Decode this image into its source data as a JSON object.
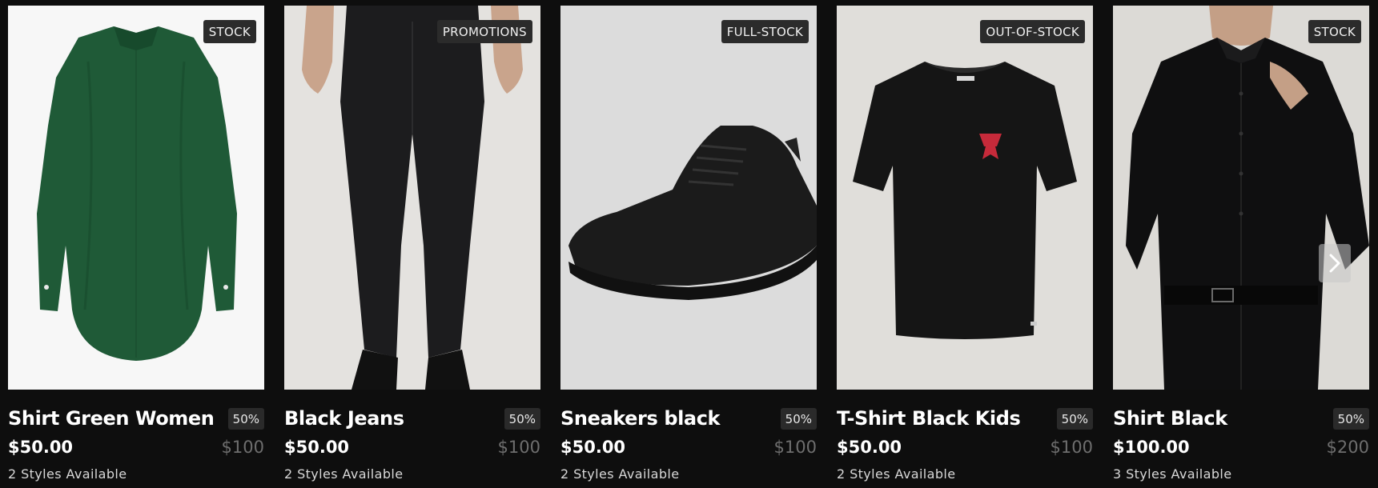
{
  "products": [
    {
      "badge": "STOCK",
      "name": "Shirt Green Women",
      "discount": "50%",
      "price": "$50.00",
      "old_price": "$100",
      "styles": "2 Styles Available"
    },
    {
      "badge": "PROMOTIONS",
      "name": "Black Jeans",
      "discount": "50%",
      "price": "$50.00",
      "old_price": "$100",
      "styles": "2 Styles Available"
    },
    {
      "badge": "FULL-STOCK",
      "name": "Sneakers black",
      "discount": "50%",
      "price": "$50.00",
      "old_price": "$100",
      "styles": "2 Styles Available"
    },
    {
      "badge": "OUT-OF-STOCK",
      "name": "T-Shirt Black Kids",
      "discount": "50%",
      "price": "$50.00",
      "old_price": "$100",
      "styles": "2 Styles Available"
    },
    {
      "badge": "STOCK",
      "name": "Shirt Black",
      "discount": "50%",
      "price": "$100.00",
      "old_price": "$200",
      "styles": "3 Styles Available"
    }
  ],
  "carousel": {
    "next_icon": "chevron-right-icon"
  },
  "colors": {
    "background": "#0e0e0e",
    "badge_bg": "#2b2b2b",
    "old_price": "#6e6e6e",
    "shirt_green": "#1f5a37",
    "tshirt_logo": "#c62a3a"
  }
}
